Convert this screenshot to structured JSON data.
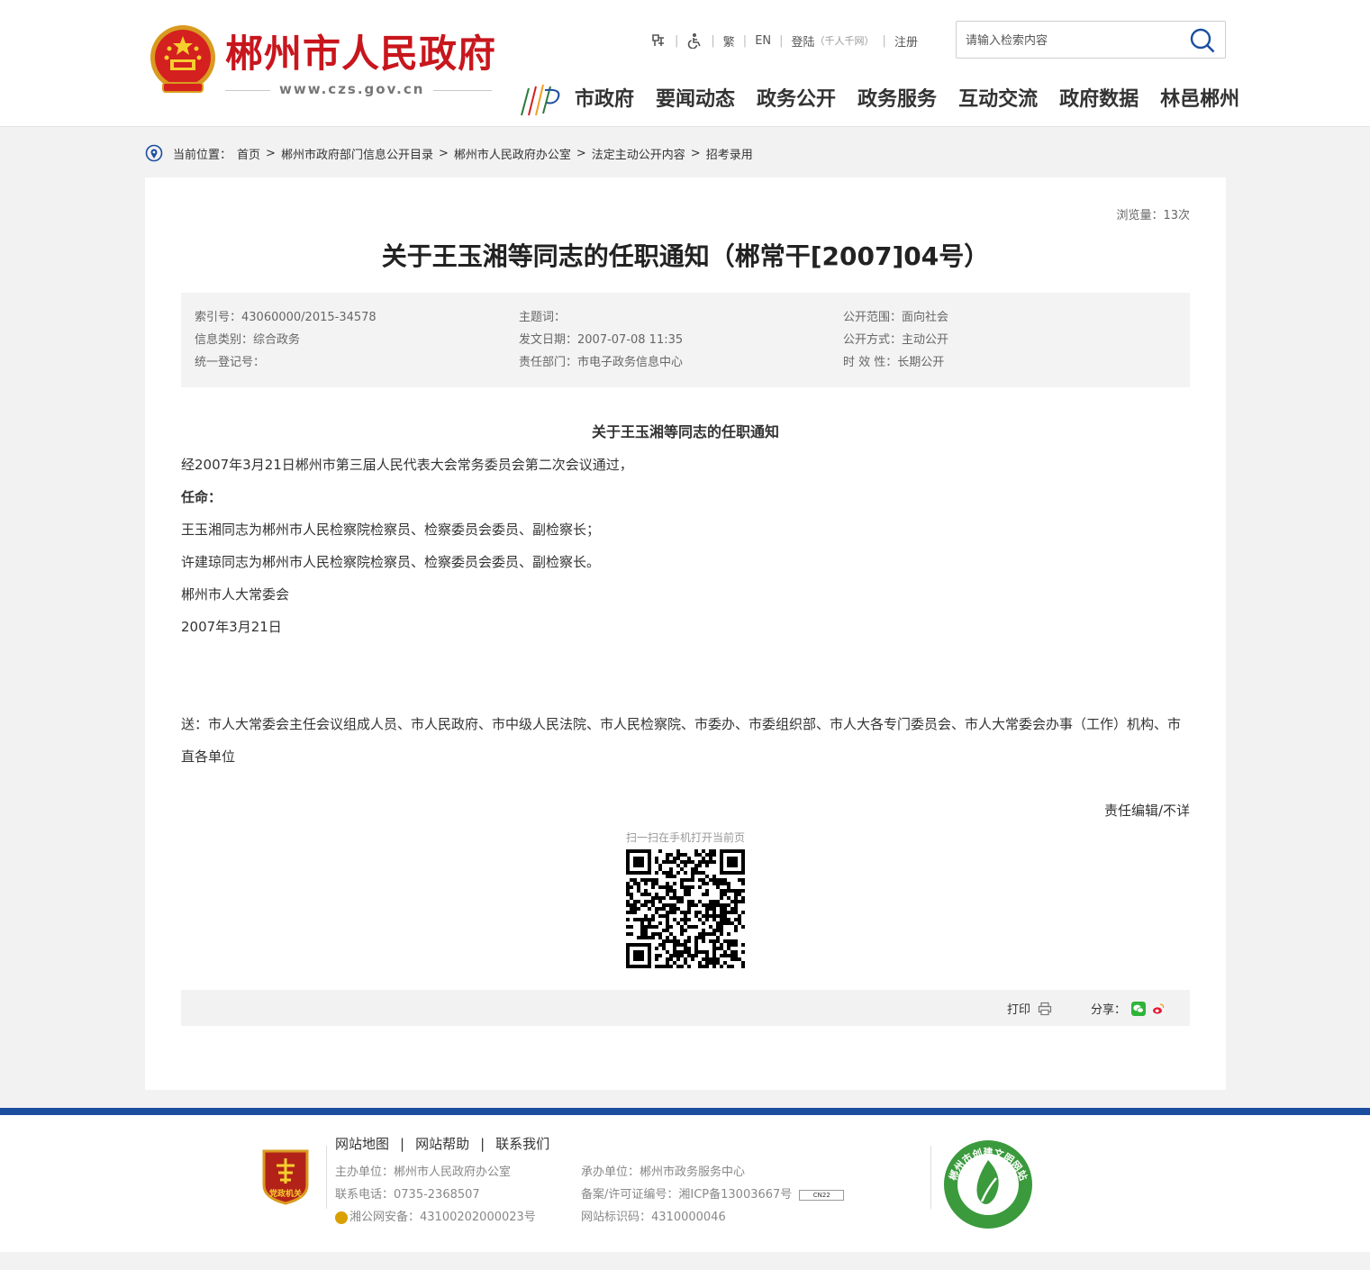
{
  "header": {
    "site_name": "郴州市人民政府",
    "site_url": "www.czs.gov.cn",
    "toplinks": {
      "simplified_traditional": "繁",
      "english": "EN",
      "login": "登陆",
      "login_sub": "（千人千网）",
      "register": "注册"
    },
    "search": {
      "placeholder": "请输入检索内容"
    },
    "nav": [
      "市政府",
      "要闻动态",
      "政务公开",
      "政务服务",
      "互动交流",
      "政府数据",
      "林邑郴州"
    ]
  },
  "breadcrumb": {
    "label": "当前位置：",
    "items": [
      "首页",
      "郴州市政府部门信息公开目录",
      "郴州市人民政府办公室",
      "法定主动公开内容",
      "招考录用"
    ]
  },
  "article": {
    "views": "浏览量：13次",
    "title": "关于王玉湘等同志的任职通知（郴常干[2007]04号）",
    "meta": {
      "index_no": "索引号：43060000/2015-34578",
      "subject": "主题词：",
      "scope": "公开范围：面向社会",
      "category": "信息类别：综合政务",
      "date": "发文日期：2007-07-08 11:35",
      "method": "公开方式：主动公开",
      "reg_no": "统一登记号：",
      "dept": "责任部门：市电子政务信息中心",
      "validity": "时 效 性：长期公开"
    },
    "sub_title": "关于王玉湘等同志的任职通知",
    "paragraphs": [
      "经2007年3月21日郴州市第三届人民代表大会常务委员会第二次会议通过，",
      "任命：",
      "王玉湘同志为郴州市人民检察院检察员、检察委员会委员、副检察长；",
      "许建琼同志为郴州市人民检察院检察员、检察委员会委员、副检察长。",
      "郴州市人大常委会",
      "2007年3月21日"
    ],
    "recipients": "送：市人大常委会主任会议组成人员、市人民政府、市中级人民法院、市人民检察院、市委办、市委组织部、市人大各专门委员会、市人大常委会办事（工作）机构、市直各单位",
    "editor": "责任编辑/不详",
    "qr_label": "扫一扫在手机打开当前页",
    "print_label": "打印",
    "share_label": "分享："
  },
  "footer": {
    "links": [
      "网站地图",
      "网站帮助",
      "联系我们"
    ],
    "host": "主办单位：郴州市人民政府办公室",
    "phone": "联系电话：0735-2368507",
    "police": "湘公网安备：43100202000023号",
    "operator": "承办单位：郴州市政务服务中心",
    "icp": "备案/许可证编号：湘ICP备13003667号",
    "site_code": "网站标识码：4310000046",
    "badge_dz_text": "党政机关",
    "badge_wm_text": "郴州市创建文明网站",
    "icp_badge_text": "CN22"
  },
  "colors": {
    "brand_red": "#c8161d",
    "footer_blue": "#1c4ea0"
  }
}
